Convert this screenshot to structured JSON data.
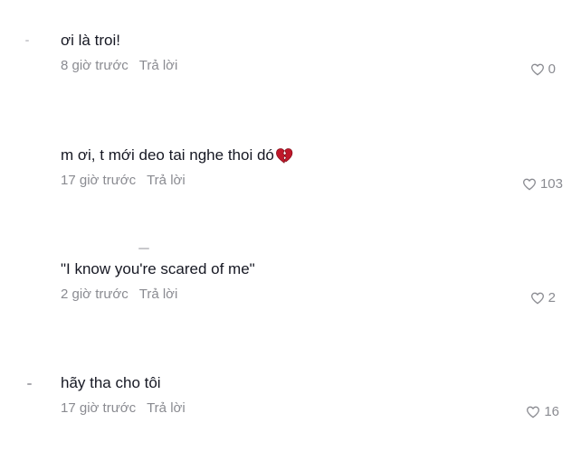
{
  "comments": [
    {
      "text": "ơi là troi!",
      "time": "8 giờ trước",
      "reply": "Trả lời",
      "likes": "0"
    },
    {
      "text": "m ơi, t mới deo tai nghe thoi dó",
      "time": "17 giờ trước",
      "reply": "Trả lời",
      "likes": "103",
      "emoji": "broken-heart-icon"
    },
    {
      "text": "\"I know you're scared of me\"",
      "time": "2 giờ trước",
      "reply": "Trả lời",
      "likes": "2"
    },
    {
      "text": "hãy tha cho tôi",
      "time": "17 giờ trước",
      "reply": "Trả lời",
      "likes": "16"
    }
  ],
  "colors": {
    "text": "#161823",
    "muted": "#8a8b91",
    "heart": "#c0182a"
  }
}
